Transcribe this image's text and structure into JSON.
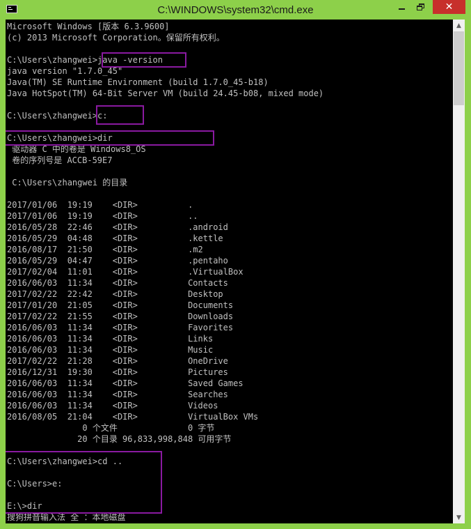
{
  "window": {
    "title": "C:\\WINDOWS\\system32\\cmd.exe",
    "icon": "cmd-icon",
    "controls": {
      "minimize": "minimize-icon",
      "maximize": "restore-icon",
      "close": "close-icon",
      "close_glyph": "✕"
    },
    "colors": {
      "frame": "#8dd04a",
      "close_button": "#c7302b",
      "console_bg": "#000000",
      "console_text": "#c0c0c0",
      "highlight_box": "#8a1aa1"
    }
  },
  "scrollbar": {
    "up_glyph": "▲",
    "down_glyph": "▼"
  },
  "console": {
    "lines": [
      "Microsoft Windows [版本 6.3.9600]",
      "(c) 2013 Microsoft Corporation。保留所有权利。",
      "",
      "C:\\Users\\zhangwei>java -version",
      "java version \"1.7.0_45\"",
      "Java(TM) SE Runtime Environment (build 1.7.0_45-b18)",
      "Java HotSpot(TM) 64-Bit Server VM (build 24.45-b08, mixed mode)",
      "",
      "C:\\Users\\zhangwei>c:",
      "",
      "C:\\Users\\zhangwei>dir",
      " 驱动器 C 中的卷是 Windows8_OS",
      " 卷的序列号是 ACCB-59E7",
      "",
      " C:\\Users\\zhangwei 的目录",
      "",
      "2017/01/06  19:19    <DIR>          .",
      "2017/01/06  19:19    <DIR>          ..",
      "2016/05/28  22:46    <DIR>          .android",
      "2016/05/29  04:48    <DIR>          .kettle",
      "2016/08/17  21:50    <DIR>          .m2",
      "2016/05/29  04:47    <DIR>          .pentaho",
      "2017/02/04  11:01    <DIR>          .VirtualBox",
      "2016/06/03  11:34    <DIR>          Contacts",
      "2017/02/22  22:42    <DIR>          Desktop",
      "2017/01/20  21:05    <DIR>          Documents",
      "2017/02/22  21:55    <DIR>          Downloads",
      "2016/06/03  11:34    <DIR>          Favorites",
      "2016/06/03  11:34    <DIR>          Links",
      "2016/06/03  11:34    <DIR>          Music",
      "2017/02/22  21:28    <DIR>          OneDrive",
      "2016/12/31  19:30    <DIR>          Pictures",
      "2016/06/03  11:34    <DIR>          Saved Games",
      "2016/06/03  11:34    <DIR>          Searches",
      "2016/06/03  11:34    <DIR>          Videos",
      "2016/08/05  21:04    <DIR>          VirtualBox VMs",
      "               0 个文件              0 字节",
      "              20 个目录 96,833,998,848 可用字节",
      "",
      "C:\\Users\\zhangwei>cd ..",
      "",
      "C:\\Users>e:",
      "",
      "E:\\>dir",
      "搜狗拼音输入法 全 ：本地磁盘"
    ]
  }
}
